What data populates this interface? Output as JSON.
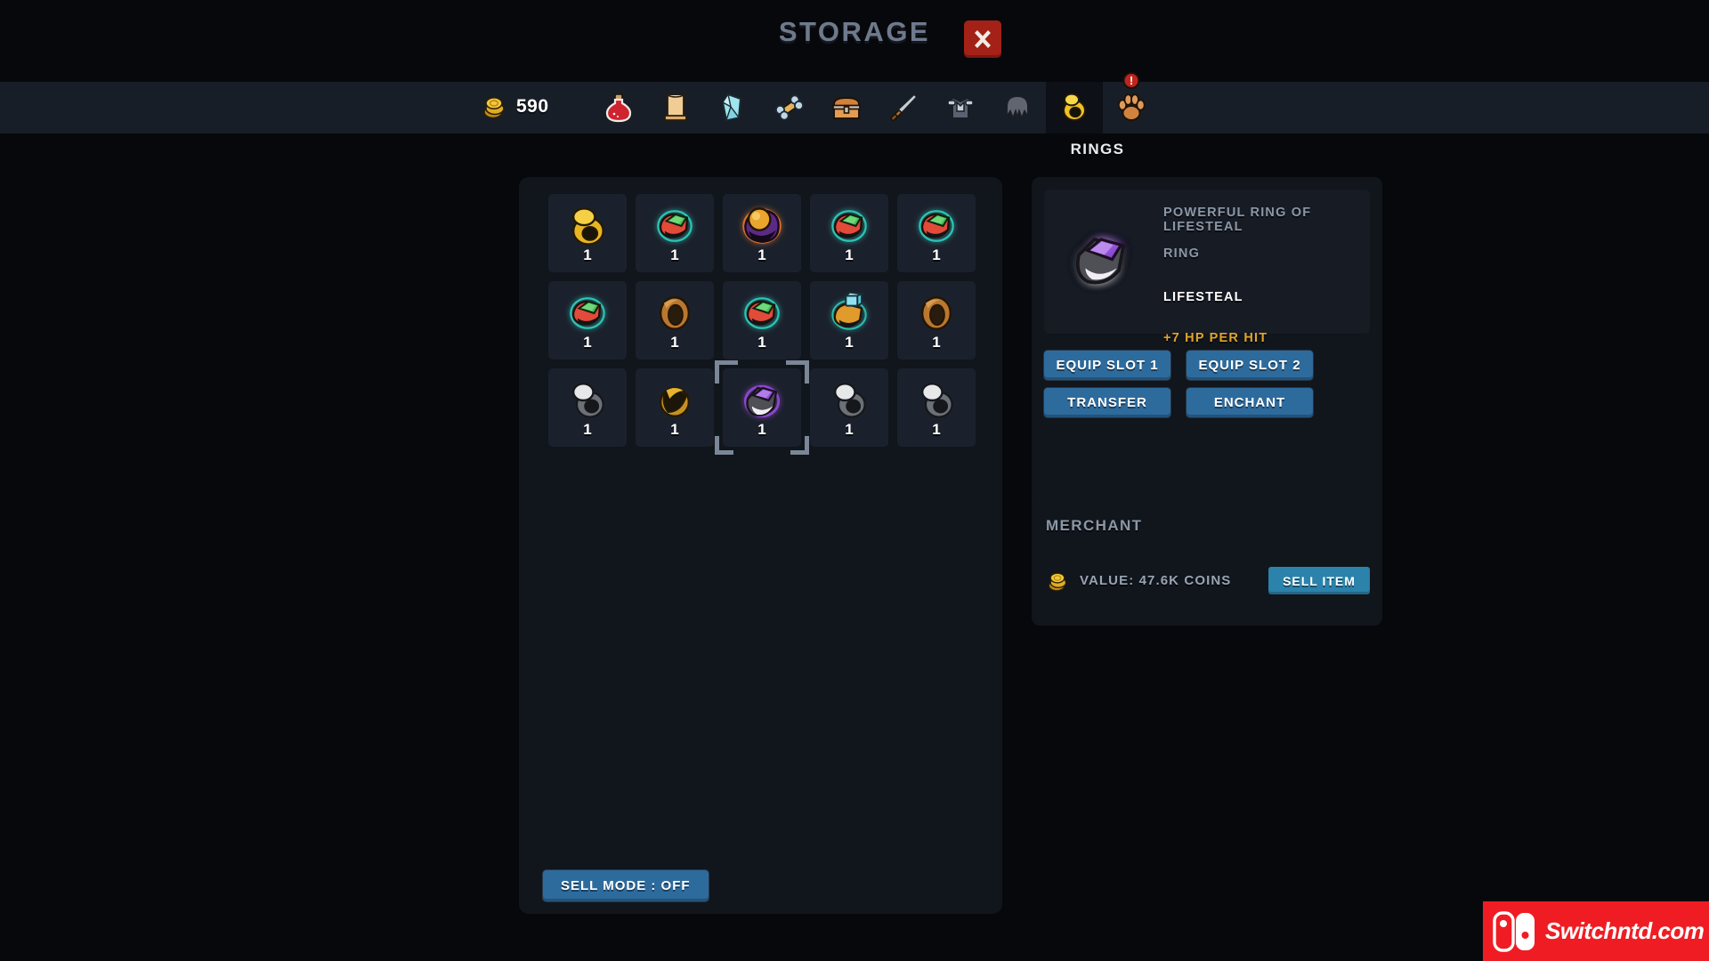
{
  "window": {
    "title": "STORAGE",
    "close_icon": "close-x-icon"
  },
  "topbar": {
    "coin_icon": "coin-stack-icon",
    "coin_count": "590",
    "active_tab_label": "RINGS",
    "tabs": [
      {
        "id": "potions",
        "icon": "potion-icon",
        "label": "POTIONS",
        "active": false,
        "badge": ""
      },
      {
        "id": "scrolls",
        "icon": "scroll-icon",
        "label": "SCROLLS",
        "active": false,
        "badge": ""
      },
      {
        "id": "gems",
        "icon": "gem-icon",
        "label": "GEMS",
        "active": false,
        "badge": ""
      },
      {
        "id": "bones",
        "icon": "bone-icon",
        "label": "BONES",
        "active": false,
        "badge": ""
      },
      {
        "id": "chests",
        "icon": "chest-icon",
        "label": "CHESTS",
        "active": false,
        "badge": ""
      },
      {
        "id": "weapons",
        "icon": "sword-icon",
        "label": "WEAPONS",
        "active": false,
        "badge": ""
      },
      {
        "id": "armor",
        "icon": "armor-icon",
        "label": "ARMOR",
        "active": false,
        "badge": ""
      },
      {
        "id": "helmets",
        "icon": "helmet-icon",
        "label": "HELMETS",
        "active": false,
        "badge": ""
      },
      {
        "id": "rings",
        "icon": "ring-icon",
        "label": "RINGS",
        "active": true,
        "badge": ""
      },
      {
        "id": "pets",
        "icon": "paw-icon",
        "label": "PETS",
        "active": false,
        "badge": "!"
      }
    ]
  },
  "inventory": {
    "sell_mode_label": "SELL MODE : OFF",
    "slots": [
      {
        "art": "ring-gold-plain",
        "qty": "1",
        "selected": false
      },
      {
        "art": "ring-rainbow-glow",
        "qty": "1",
        "selected": false
      },
      {
        "art": "ring-orb-purple",
        "qty": "1",
        "selected": false
      },
      {
        "art": "ring-rainbow-glow",
        "qty": "1",
        "selected": false
      },
      {
        "art": "ring-rainbow-glow",
        "qty": "1",
        "selected": false
      },
      {
        "art": "ring-rainbow-glow",
        "qty": "1",
        "selected": false
      },
      {
        "art": "ring-bronze-plain",
        "qty": "1",
        "selected": false
      },
      {
        "art": "ring-rainbow-glow",
        "qty": "1",
        "selected": false
      },
      {
        "art": "ring-gold-cyan-gem",
        "qty": "1",
        "selected": false
      },
      {
        "art": "ring-bronze-plain",
        "qty": "1",
        "selected": false
      },
      {
        "art": "ring-silver-plain",
        "qty": "1",
        "selected": false
      },
      {
        "art": "ring-gold-dark",
        "qty": "1",
        "selected": false
      },
      {
        "art": "ring-purple-gem",
        "qty": "1",
        "selected": true
      },
      {
        "art": "ring-silver-plain",
        "qty": "1",
        "selected": false
      },
      {
        "art": "ring-silver-plain",
        "qty": "1",
        "selected": false
      }
    ]
  },
  "detail": {
    "item_art": "ring-purple-gem-large",
    "item_name": "POWERFUL RING OF LIFESTEAL",
    "item_type": "RING",
    "item_effect": "LIFESTEAL",
    "item_bonus": "+7 HP PER HIT",
    "actions": [
      {
        "id": "equip-slot-1",
        "label": "EQUIP SLOT 1"
      },
      {
        "id": "equip-slot-2",
        "label": "EQUIP SLOT 2"
      },
      {
        "id": "transfer",
        "label": "TRANSFER"
      },
      {
        "id": "enchant",
        "label": "ENCHANT"
      }
    ]
  },
  "merchant": {
    "title": "MERCHANT",
    "coin_icon": "coin-stack-icon",
    "value_text": "VALUE:  47.6K COINS",
    "sell_label": "SELL ITEM"
  },
  "watermark": {
    "text": "Switchntd.com",
    "icon": "nintendo-switch-icon",
    "color": "#ef1d23"
  },
  "colors": {
    "bg": "#07080b",
    "panel": "#11151c",
    "slot": "#1b212c",
    "topbar": "#181e27",
    "accent_blue": "#2e6b9d",
    "accent_gold": "#e0a428",
    "close_red": "#a32117",
    "badge_red": "#c0241c",
    "text_muted": "#8b97a6"
  }
}
